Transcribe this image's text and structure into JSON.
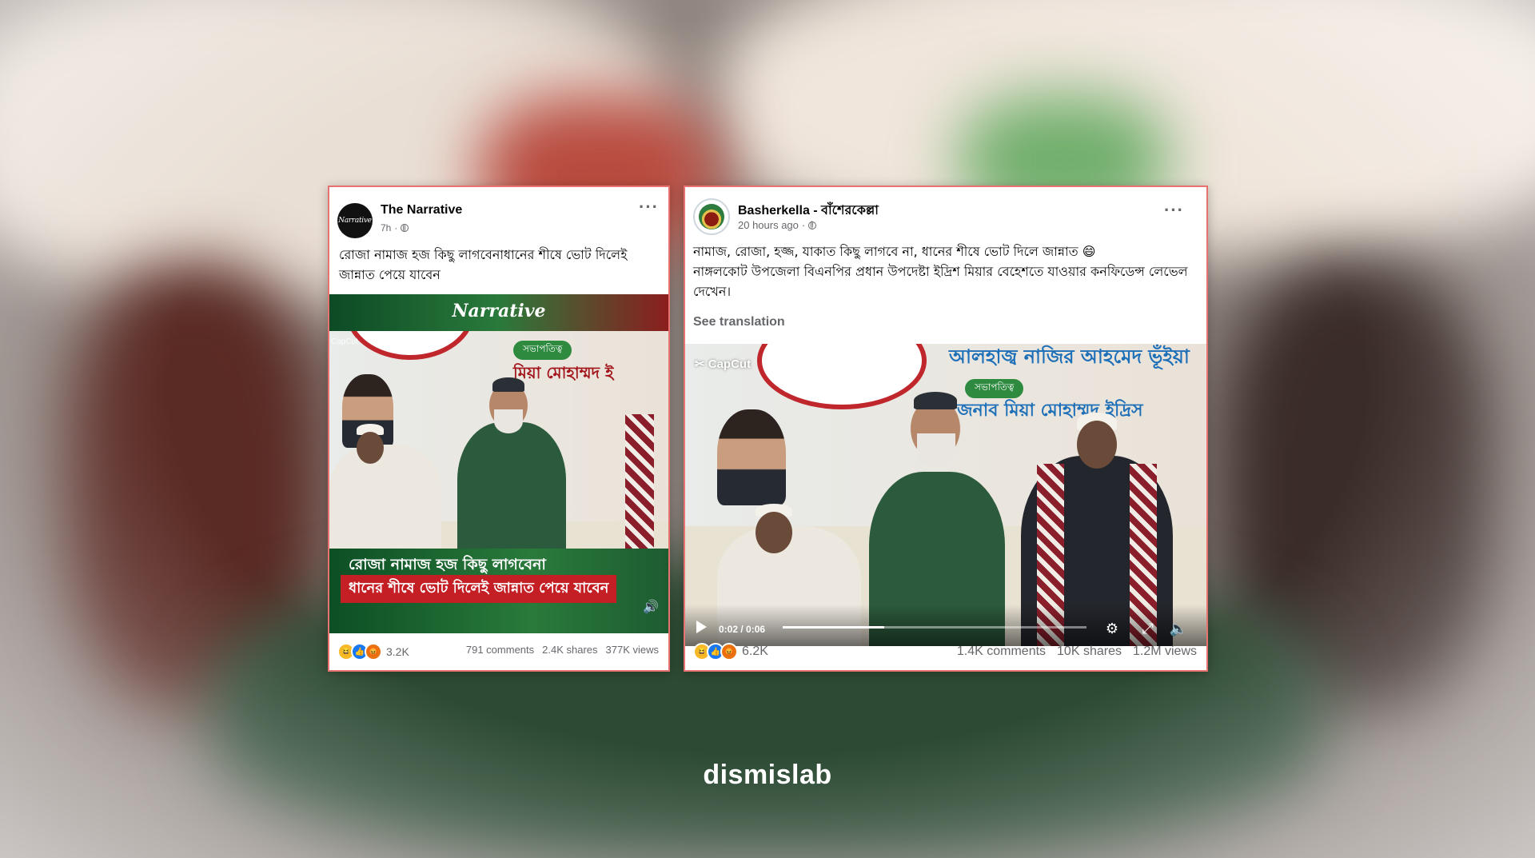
{
  "post1": {
    "page_name": "The Narrative",
    "avatar_text": "Narrative",
    "time": "7h",
    "caption": "রোজা নামাজ হজ কিছু লাগবেনাধানের শীষে ভোট দিলেই জান্নাত পেয়ে যাবেন",
    "video_logo": "Narrative",
    "capcut": "CapCut",
    "overlay_line1": "রোজা নামাজ হজ কিছু লাগবেনা",
    "overlay_line2": "ধানের শীষে ভোট দিলেই জান্নাত পেয়ে যাবেন",
    "banner_text": "মিয়া মোহাম্মদ ই",
    "reaction_count": "3.2K",
    "comments": "791 comments",
    "shares": "2.4K shares",
    "views": "377K views"
  },
  "post2": {
    "page_name": "Basherkella - বাঁশেরকেল্লা",
    "time": "20 hours ago",
    "caption_line1": "নামাজ, রোজা, হজ্জ, যাকাত কিছু লাগবে না, ধানের শীষে ভোট দিলে জান্নাত 😄",
    "caption_line2": "নাঙ্গলকোট উপজেলা বিএনপির প্রধান উপদেষ্টা ইদ্রিশ মিয়ার বেহেশতে যাওয়ার কনফিডেন্স লেভেল দেখেন।",
    "see_translation": "See translation",
    "capcut": "CapCut",
    "banner_top": "আলহাজ্ব নাজির আহমেদ ভূঁইয়া",
    "banner_pill": "সভাপতিত্ব",
    "banner_mid": "জনাব মিয়া মোহাম্মদ ইদ্রিস",
    "video_time": "0:02 / 0:06",
    "video_progress": 0.333,
    "reaction_count": "6.2K",
    "comments": "1.4K comments",
    "shares": "10K shares",
    "views": "1.2M views"
  },
  "brand": "dismislab",
  "colors": {
    "card_border": "#e8726f",
    "haha": "#f7b928",
    "like": "#1877f2",
    "angry": "#e9710f"
  }
}
